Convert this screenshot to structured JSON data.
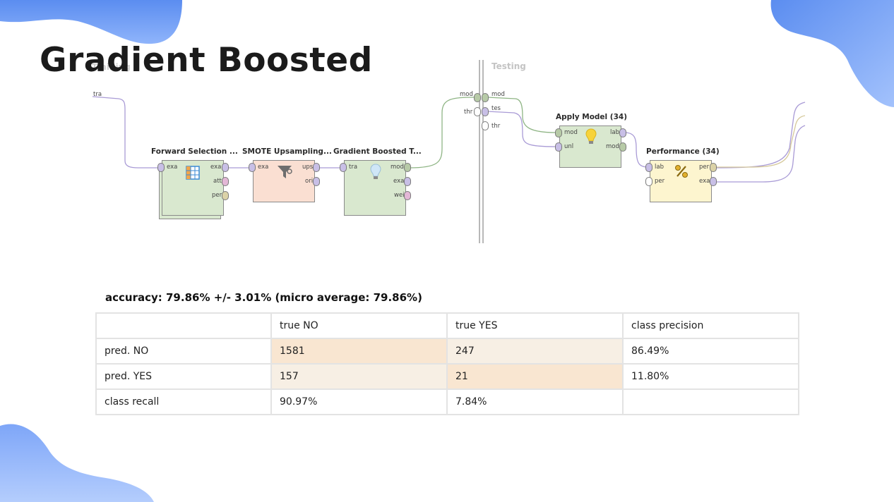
{
  "slide": {
    "title": "Gradient Boosted"
  },
  "process": {
    "sections": {
      "training": "Training",
      "testing": "Testing"
    },
    "source_port": "tra",
    "divider_ports": {
      "in": [
        "mod",
        "thr"
      ],
      "out": [
        "mod",
        "tes",
        "thr"
      ]
    },
    "operators": [
      {
        "title": "Forward Selection ...",
        "inputs": [
          "exa"
        ],
        "outputs": [
          "exa",
          "att",
          "per"
        ],
        "icon": "table-icon"
      },
      {
        "title": "SMOTE Upsampling...",
        "inputs": [
          "exa"
        ],
        "outputs": [
          "ups",
          "ori"
        ],
        "icon": "filter-icon"
      },
      {
        "title": "Gradient Boosted T...",
        "inputs": [
          "tra"
        ],
        "outputs": [
          "mod",
          "exa",
          "wei"
        ],
        "icon": "lightbulb-icon"
      },
      {
        "title": "Apply Model (34)",
        "inputs": [
          "mod",
          "unl"
        ],
        "outputs": [
          "lab",
          "mod"
        ],
        "icon": "lightbulb-icon"
      },
      {
        "title": "Performance (34)",
        "inputs": [
          "lab",
          "per"
        ],
        "outputs": [
          "per",
          "exa"
        ],
        "icon": "percent-icon"
      }
    ]
  },
  "results": {
    "accuracy": "accuracy: 79.86% +/- 3.01% (micro average: 79.86%)",
    "header": [
      "",
      "true NO",
      "true YES",
      "class precision"
    ],
    "rows": [
      [
        "pred. NO",
        "1581",
        "247",
        "86.49%"
      ],
      [
        "pred. YES",
        "157",
        "21",
        "11.80%"
      ],
      [
        "class recall",
        "90.97%",
        "7.84%",
        ""
      ]
    ]
  },
  "colors": {
    "accent_blue": "#5b8df0",
    "operator_green": "#d9e8cf",
    "operator_peach": "#fadfd2",
    "operator_yellow": "#fdf5cf",
    "cell_high": "#f9e6d1",
    "cell_low": "#f7efe4"
  }
}
